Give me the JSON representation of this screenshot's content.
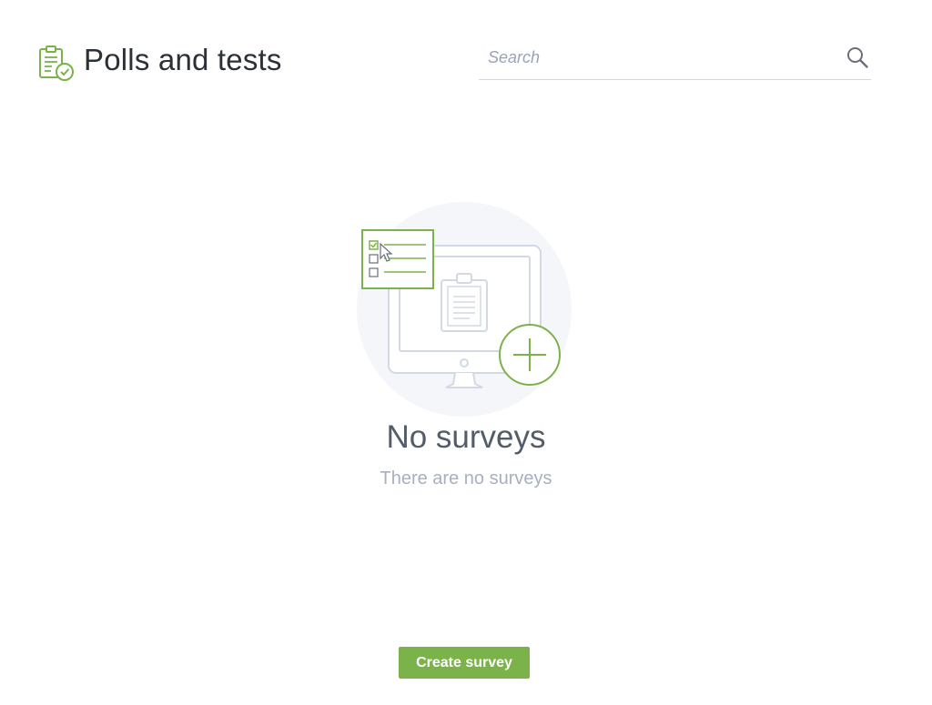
{
  "header": {
    "title": "Polls and tests",
    "logo_icon": "clipboard-check-icon"
  },
  "search": {
    "placeholder": "Search",
    "value": "",
    "icon": "search-icon"
  },
  "empty_state": {
    "illustration_icon": "survey-monitor-add-illustration",
    "title": "No surveys",
    "subtitle": "There are no surveys"
  },
  "actions": {
    "create_label": "Create survey"
  },
  "colors": {
    "accent": "#7bb24a",
    "title_text": "#2c3037",
    "muted_text": "#a8afbe",
    "empty_title_text": "#535c69",
    "illustration_bg": "#f5f6fa",
    "illustration_line": "#d3d8e6"
  }
}
